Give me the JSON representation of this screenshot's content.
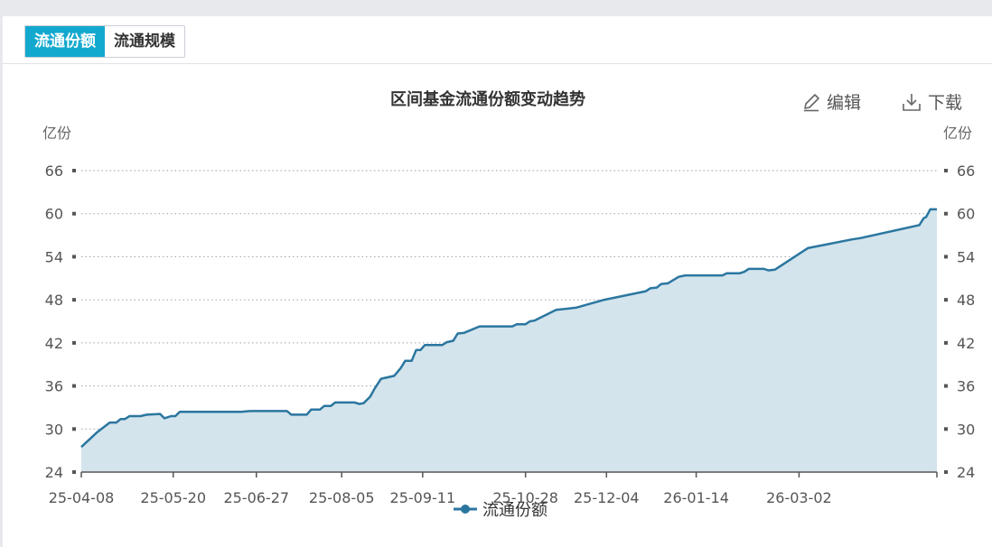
{
  "tabs": [
    {
      "label": "流通份额",
      "active": true
    },
    {
      "label": "流通规模",
      "active": false
    }
  ],
  "toolbar": {
    "edit_label": "编辑",
    "download_label": "下载"
  },
  "colors": {
    "accent": "#13a9cf",
    "line": "#2b76a0",
    "area": "#d3e4ec"
  },
  "chart_data": {
    "type": "area",
    "title": "区间基金流通份额变动趋势",
    "y_unit_left": "亿份",
    "y_unit_right": "亿份",
    "ylim": [
      24,
      66
    ],
    "yticks": [
      24,
      30,
      36,
      42,
      48,
      54,
      60,
      66
    ],
    "xticks": [
      "25-04-08",
      "25-05-20",
      "25-06-27",
      "25-08-05",
      "25-09-11",
      "25-10-28",
      "25-12-04",
      "26-01-14",
      "26-03-02"
    ],
    "grid": true,
    "legend_position": "bottom",
    "series": [
      {
        "name": "流通份额",
        "points": [
          [
            "2025-04-08",
            27.5
          ],
          [
            "2025-04-15",
            29.5
          ],
          [
            "2025-04-21",
            30.9
          ],
          [
            "2025-04-24",
            30.9
          ],
          [
            "2025-04-26",
            31.4
          ],
          [
            "2025-04-28",
            31.4
          ],
          [
            "2025-04-30",
            31.8
          ],
          [
            "2025-05-05",
            31.8
          ],
          [
            "2025-05-08",
            32.0
          ],
          [
            "2025-05-14",
            32.1
          ],
          [
            "2025-05-16",
            31.5
          ],
          [
            "2025-05-19",
            31.8
          ],
          [
            "2025-05-21",
            31.8
          ],
          [
            "2025-05-23",
            32.4
          ],
          [
            "2025-06-05",
            32.4
          ],
          [
            "2025-06-20",
            32.4
          ],
          [
            "2025-06-24",
            32.5
          ],
          [
            "2025-07-11",
            32.5
          ],
          [
            "2025-07-13",
            32.0
          ],
          [
            "2025-07-20",
            32.0
          ],
          [
            "2025-07-22",
            32.7
          ],
          [
            "2025-07-26",
            32.7
          ],
          [
            "2025-07-28",
            33.2
          ],
          [
            "2025-07-31",
            33.2
          ],
          [
            "2025-08-02",
            33.7
          ],
          [
            "2025-08-11",
            33.7
          ],
          [
            "2025-08-13",
            33.5
          ],
          [
            "2025-08-15",
            33.6
          ],
          [
            "2025-08-18",
            34.5
          ],
          [
            "2025-08-20",
            35.6
          ],
          [
            "2025-08-23",
            37.0
          ],
          [
            "2025-08-26",
            37.2
          ],
          [
            "2025-08-29",
            37.4
          ],
          [
            "2025-09-01",
            38.5
          ],
          [
            "2025-09-03",
            39.5
          ],
          [
            "2025-09-06",
            39.5
          ],
          [
            "2025-09-08",
            41.0
          ],
          [
            "2025-09-10",
            41.0
          ],
          [
            "2025-09-12",
            41.7
          ],
          [
            "2025-09-20",
            41.7
          ],
          [
            "2025-09-22",
            42.1
          ],
          [
            "2025-09-25",
            42.3
          ],
          [
            "2025-09-27",
            43.3
          ],
          [
            "2025-09-30",
            43.4
          ],
          [
            "2025-10-07",
            44.3
          ],
          [
            "2025-10-22",
            44.3
          ],
          [
            "2025-10-24",
            44.6
          ],
          [
            "2025-10-28",
            44.6
          ],
          [
            "2025-10-30",
            45.0
          ],
          [
            "2025-11-01",
            45.1
          ],
          [
            "2025-11-11",
            46.6
          ],
          [
            "2025-11-17",
            46.8
          ],
          [
            "2025-11-20",
            46.9
          ],
          [
            "2025-12-03",
            48.0
          ],
          [
            "2025-12-22",
            49.2
          ],
          [
            "2025-12-24",
            49.6
          ],
          [
            "2025-12-27",
            49.7
          ],
          [
            "2025-12-29",
            50.2
          ],
          [
            "2026-01-01",
            50.3
          ],
          [
            "2026-01-06",
            51.2
          ],
          [
            "2026-01-09",
            51.4
          ],
          [
            "2026-01-26",
            51.4
          ],
          [
            "2026-01-28",
            51.7
          ],
          [
            "2026-02-03",
            51.7
          ],
          [
            "2026-02-05",
            51.9
          ],
          [
            "2026-02-07",
            52.3
          ],
          [
            "2026-02-14",
            52.3
          ],
          [
            "2026-02-16",
            52.1
          ],
          [
            "2026-02-19",
            52.2
          ],
          [
            "2026-03-06",
            55.2
          ],
          [
            "2026-03-16",
            55.8
          ],
          [
            "2026-03-26",
            56.4
          ],
          [
            "2026-03-30",
            56.6
          ],
          [
            "2026-04-26",
            58.4
          ],
          [
            "2026-04-28",
            59.4
          ],
          [
            "2026-04-29",
            59.5
          ],
          [
            "2026-05-01",
            60.6
          ],
          [
            "2026-05-04",
            60.6
          ]
        ]
      }
    ]
  }
}
